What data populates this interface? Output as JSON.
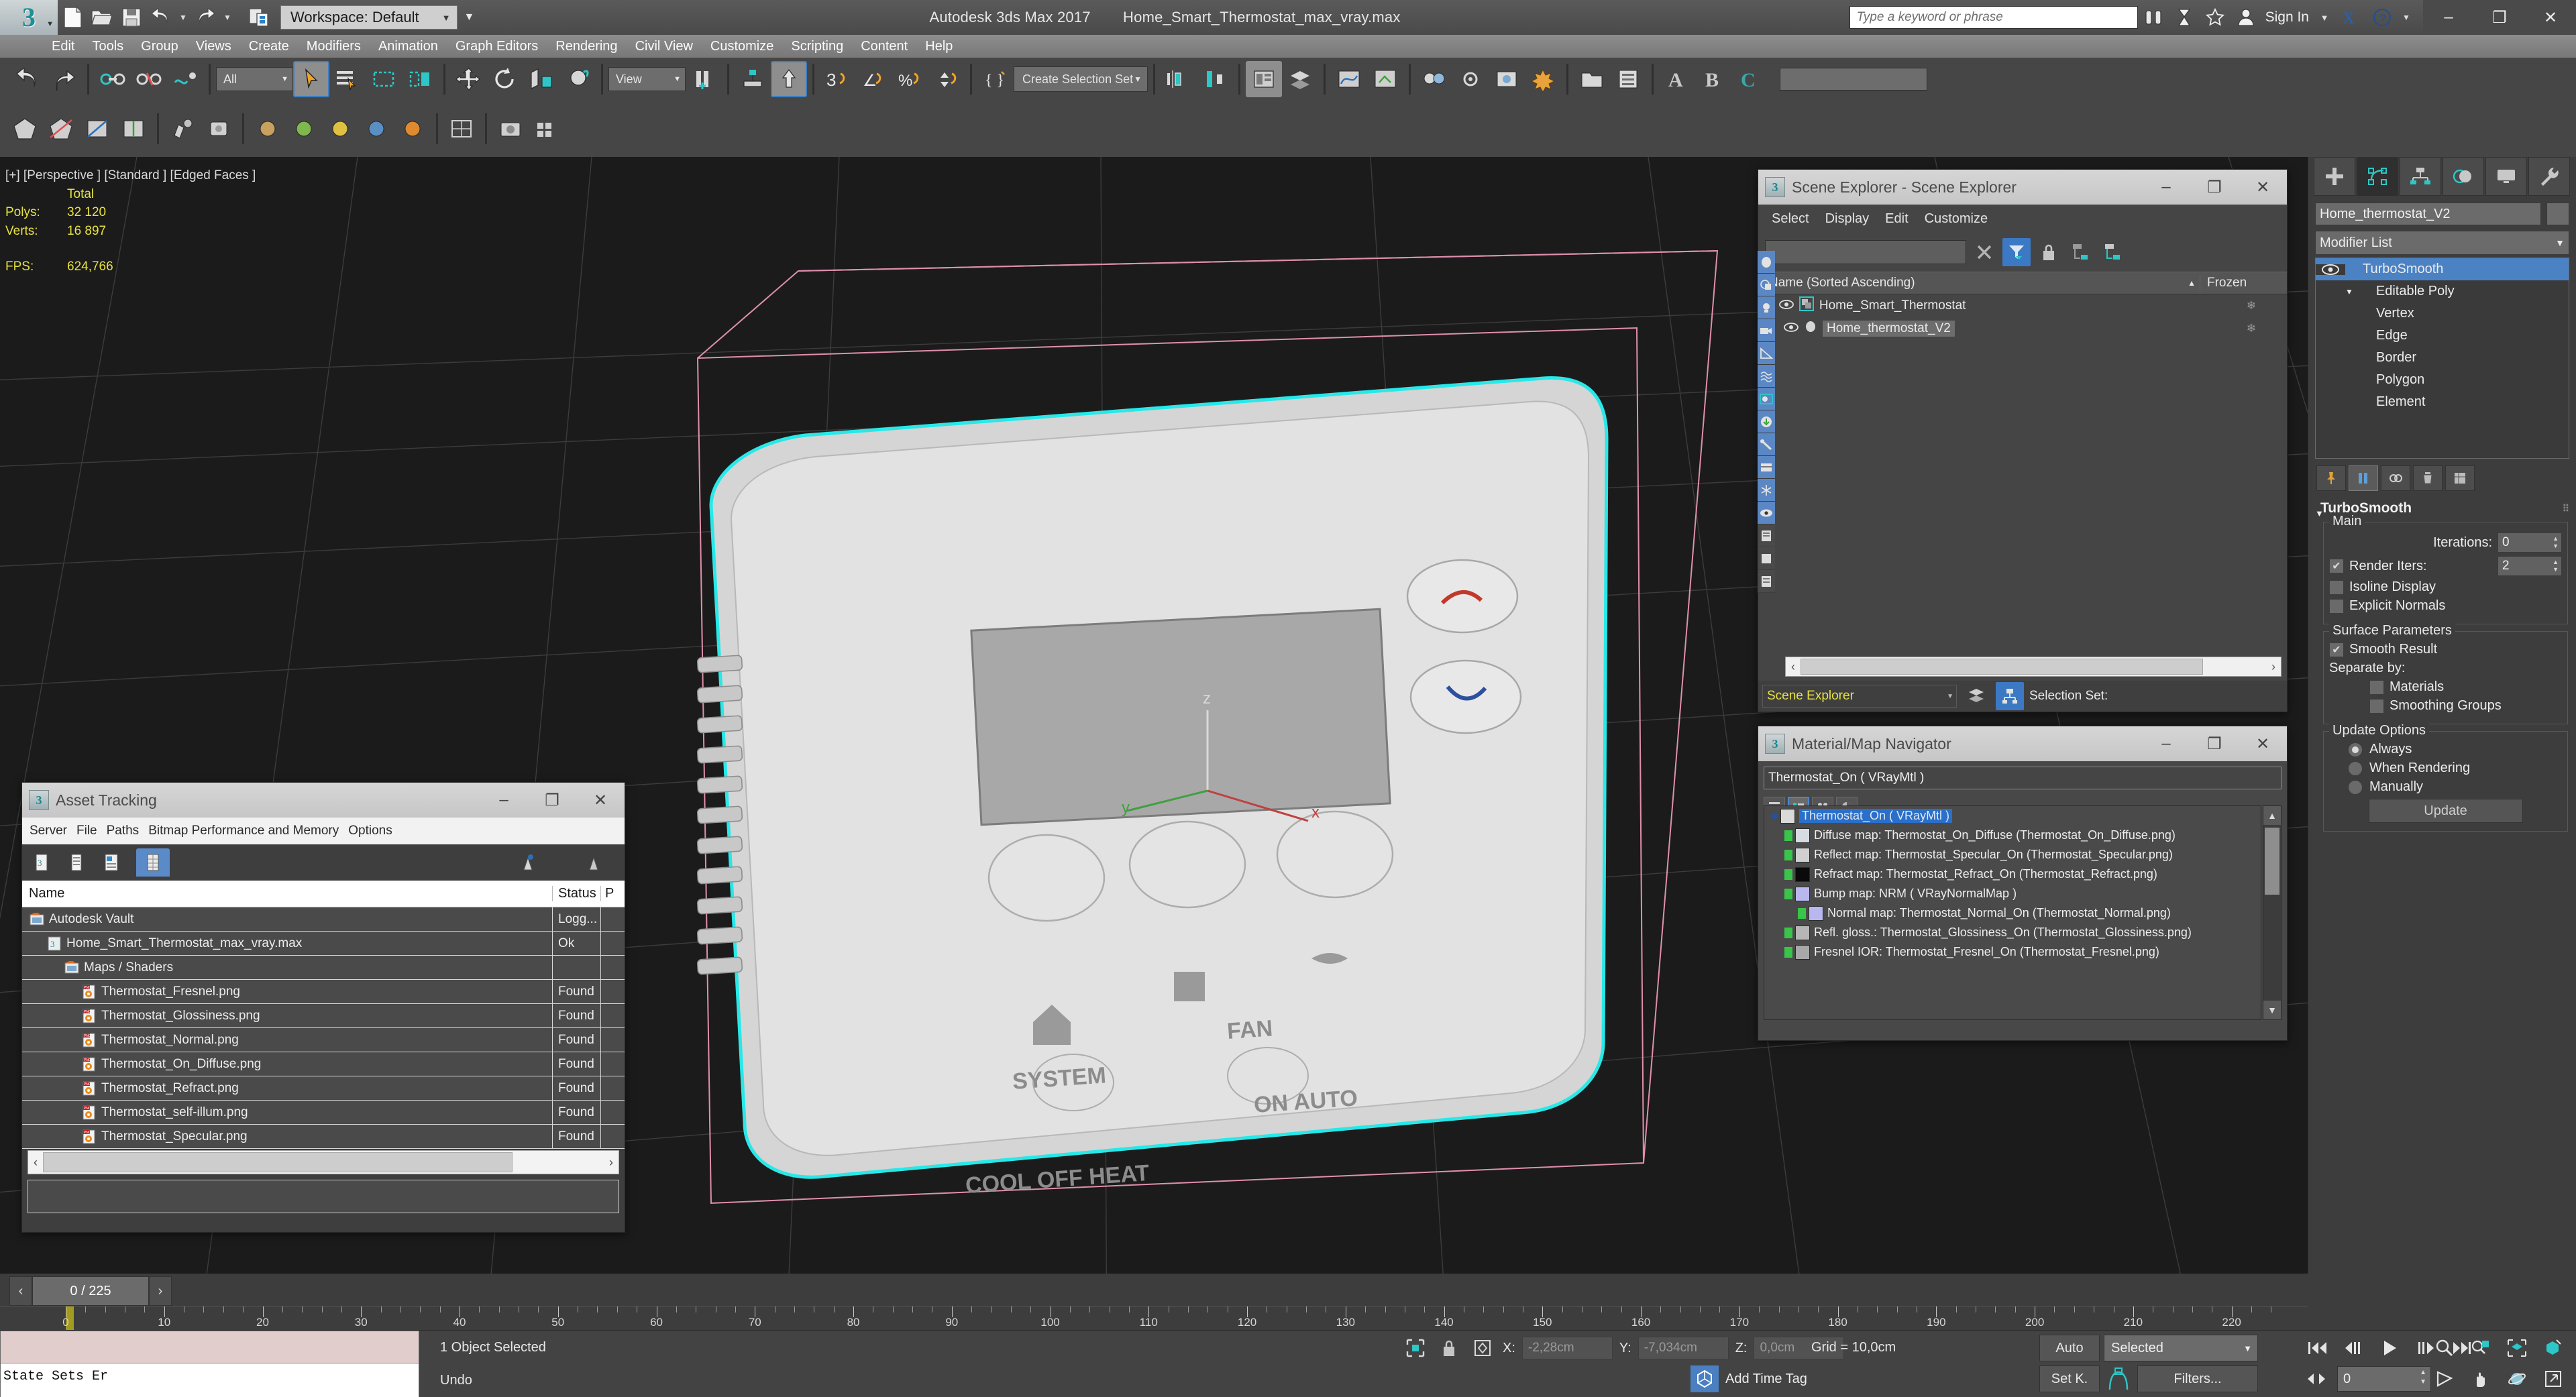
{
  "titlebar": {
    "workspace_label": "Workspace: Default",
    "app_title": "Autodesk 3ds Max 2017",
    "file_name": "Home_Smart_Thermostat_max_vray.max",
    "search_placeholder": "Type a keyword or phrase",
    "sign_in": "Sign In",
    "minimize": "–",
    "restore": "❐",
    "close": "✕",
    "quick_icons": [
      "new-icon",
      "open-icon",
      "save-icon",
      "undo-icon",
      "redo-icon",
      "set-project-icon"
    ]
  },
  "menubar": {
    "items": [
      "Edit",
      "Tools",
      "Group",
      "Views",
      "Create",
      "Modifiers",
      "Animation",
      "Graph Editors",
      "Rendering",
      "Civil View",
      "Customize",
      "Scripting",
      "Content",
      "Help"
    ]
  },
  "toolbar": {
    "selection_filter": "All",
    "reference_coord": "View",
    "selection_set_placeholder": "Create Selection Set"
  },
  "viewport": {
    "label": "[+] [Perspective ] [Standard ] [Edged Faces ]",
    "total_label": "Total",
    "polys_label": "Polys:",
    "polys_value": "32 120",
    "verts_label": "Verts:",
    "verts_value": "16 897",
    "fps_label": "FPS:",
    "fps_value": "624,766",
    "axis_x": "x",
    "axis_y": "y",
    "axis_z": "z"
  },
  "scene_explorer": {
    "title": "Scene Explorer - Scene Explorer",
    "menu": [
      "Select",
      "Display",
      "Edit",
      "Customize"
    ],
    "columns": [
      "Name (Sorted Ascending)",
      "Frozen"
    ],
    "rows": [
      {
        "name": "Home_Smart_Thermostat",
        "level": 0,
        "selected": false
      },
      {
        "name": "Home_thermostat_V2",
        "level": 1,
        "selected": true
      }
    ],
    "footer_name": "Scene Explorer",
    "selection_set_label": "Selection Set:"
  },
  "material_navigator": {
    "title": "Material/Map Navigator",
    "current": "Thermostat_On  ( VRayMtl )",
    "rows": [
      {
        "text": "Thermostat_On  ( VRayMtl )",
        "level": 0,
        "selected": true,
        "swatch": "#d9d9d9"
      },
      {
        "text": "Diffuse map: Thermostat_On_Diffuse (Thermostat_On_Diffuse.png)",
        "level": 1,
        "selected": false,
        "swatch": "#d7dce2"
      },
      {
        "text": "Reflect map: Thermostat_Specular_On (Thermostat_Specular.png)",
        "level": 1,
        "selected": false,
        "swatch": "#d0d0d0"
      },
      {
        "text": "Refract map: Thermostat_Refract_On (Thermostat_Refract.png)",
        "level": 1,
        "selected": false,
        "swatch": "#0a0a0a"
      },
      {
        "text": "Bump map: NRM  ( VRayNormalMap )",
        "level": 1,
        "selected": false,
        "swatch": "#b9b8ee"
      },
      {
        "text": "Normal map: Thermostat_Normal_On (Thermostat_Normal.png)",
        "level": 2,
        "selected": false,
        "swatch": "#b9b8ee"
      },
      {
        "text": "Refl. gloss.: Thermostat_Glossiness_On (Thermostat_Glossiness.png)",
        "level": 1,
        "selected": false,
        "swatch": "#b6b6b6"
      },
      {
        "text": "Fresnel IOR: Thermostat_Fresnel_On (Thermostat_Fresnel.png)",
        "level": 1,
        "selected": false,
        "swatch": "#a8a8a8"
      }
    ]
  },
  "asset_tracking": {
    "title": "Asset Tracking",
    "menu": [
      "Server",
      "File",
      "Paths",
      "Bitmap Performance and Memory",
      "Options"
    ],
    "columns": [
      "Name",
      "Status",
      "P"
    ],
    "rows": [
      {
        "name": "Autodesk Vault",
        "status": "Logg...",
        "indent": 0,
        "icon": "vault-icon"
      },
      {
        "name": "Home_Smart_Thermostat_max_vray.max",
        "status": "Ok",
        "indent": 1,
        "icon": "max-file-icon"
      },
      {
        "name": "Maps / Shaders",
        "status": "",
        "indent": 2,
        "icon": "folder-icon"
      },
      {
        "name": "Thermostat_Fresnel.png",
        "status": "Found",
        "indent": 3,
        "icon": "png-icon"
      },
      {
        "name": "Thermostat_Glossiness.png",
        "status": "Found",
        "indent": 3,
        "icon": "png-icon"
      },
      {
        "name": "Thermostat_Normal.png",
        "status": "Found",
        "indent": 3,
        "icon": "png-icon"
      },
      {
        "name": "Thermostat_On_Diffuse.png",
        "status": "Found",
        "indent": 3,
        "icon": "png-icon"
      },
      {
        "name": "Thermostat_Refract.png",
        "status": "Found",
        "indent": 3,
        "icon": "png-icon"
      },
      {
        "name": "Thermostat_self-illum.png",
        "status": "Found",
        "indent": 3,
        "icon": "png-icon"
      },
      {
        "name": "Thermostat_Specular.png",
        "status": "Found",
        "indent": 3,
        "icon": "png-icon"
      }
    ]
  },
  "command_panel": {
    "object_name": "Home_thermostat_V2",
    "modifier_list_label": "Modifier List",
    "stack": [
      {
        "label": "TurboSmooth",
        "level": 0,
        "selected": true,
        "has_eye": true
      },
      {
        "label": "Editable Poly",
        "level": 0,
        "selected": false,
        "has_eye": false
      },
      {
        "label": "Vertex",
        "level": 1,
        "selected": false,
        "has_eye": false
      },
      {
        "label": "Edge",
        "level": 1,
        "selected": false,
        "has_eye": false
      },
      {
        "label": "Border",
        "level": 1,
        "selected": false,
        "has_eye": false
      },
      {
        "label": "Polygon",
        "level": 1,
        "selected": false,
        "has_eye": false
      },
      {
        "label": "Element",
        "level": 1,
        "selected": false,
        "has_eye": false
      }
    ],
    "rollout": {
      "title": "TurboSmooth",
      "main_label": "Main",
      "iterations_label": "Iterations:",
      "iterations_value": "0",
      "render_iters_label": "Render Iters:",
      "render_iters_value": "2",
      "render_iters_checked": true,
      "isoline_label": "Isoline Display",
      "isoline_checked": false,
      "explicit_normals_label": "Explicit Normals",
      "explicit_normals_checked": false,
      "surface_params_label": "Surface Parameters",
      "smooth_result_label": "Smooth Result",
      "smooth_result_checked": true,
      "separate_by_label": "Separate by:",
      "materials_label": "Materials",
      "materials_checked": false,
      "smoothing_groups_label": "Smoothing Groups",
      "smoothing_groups_checked": false,
      "update_options_label": "Update Options",
      "always_label": "Always",
      "when_rendering_label": "When Rendering",
      "manually_label": "Manually",
      "selected_update": "Always",
      "update_button": "Update"
    }
  },
  "timeline": {
    "frame_display": "0 / 225",
    "prev_arrow": "‹",
    "next_arrow": "›",
    "tick_labels": [
      "0",
      "10",
      "20",
      "30",
      "40",
      "50",
      "60",
      "70",
      "80",
      "90",
      "100",
      "110",
      "120",
      "130",
      "140",
      "150",
      "160",
      "170",
      "180",
      "190",
      "200",
      "210",
      "220"
    ],
    "current_frame": 0,
    "total_frames": 225
  },
  "statusbar": {
    "state_sets_text": "State Sets Er",
    "prompt_line1": "1 Object Selected",
    "prompt_line2": "Undo",
    "x_label": "X:",
    "x_value": "-2,28cm",
    "y_label": "Y:",
    "y_value": "-7,034cm",
    "z_label": "Z:",
    "z_value": "0,0cm",
    "grid_label": "Grid = 10,0cm",
    "add_time_tag": "Add Time Tag",
    "auto_key": "Auto",
    "set_key": "Set K.",
    "key_filter_combo": "Selected",
    "filters_button": "Filters...",
    "key_spinner_value": "0"
  },
  "colors": {
    "accent_blue": "#4b82c4",
    "teal": "#2ec6c6",
    "highlight_yellow": "#e8e241",
    "selection_cyan": "#2ae3e3",
    "panel_bg": "#3d3d3d",
    "toolbar_bg": "#464646",
    "viewport_bg": "#1b1b1b"
  }
}
